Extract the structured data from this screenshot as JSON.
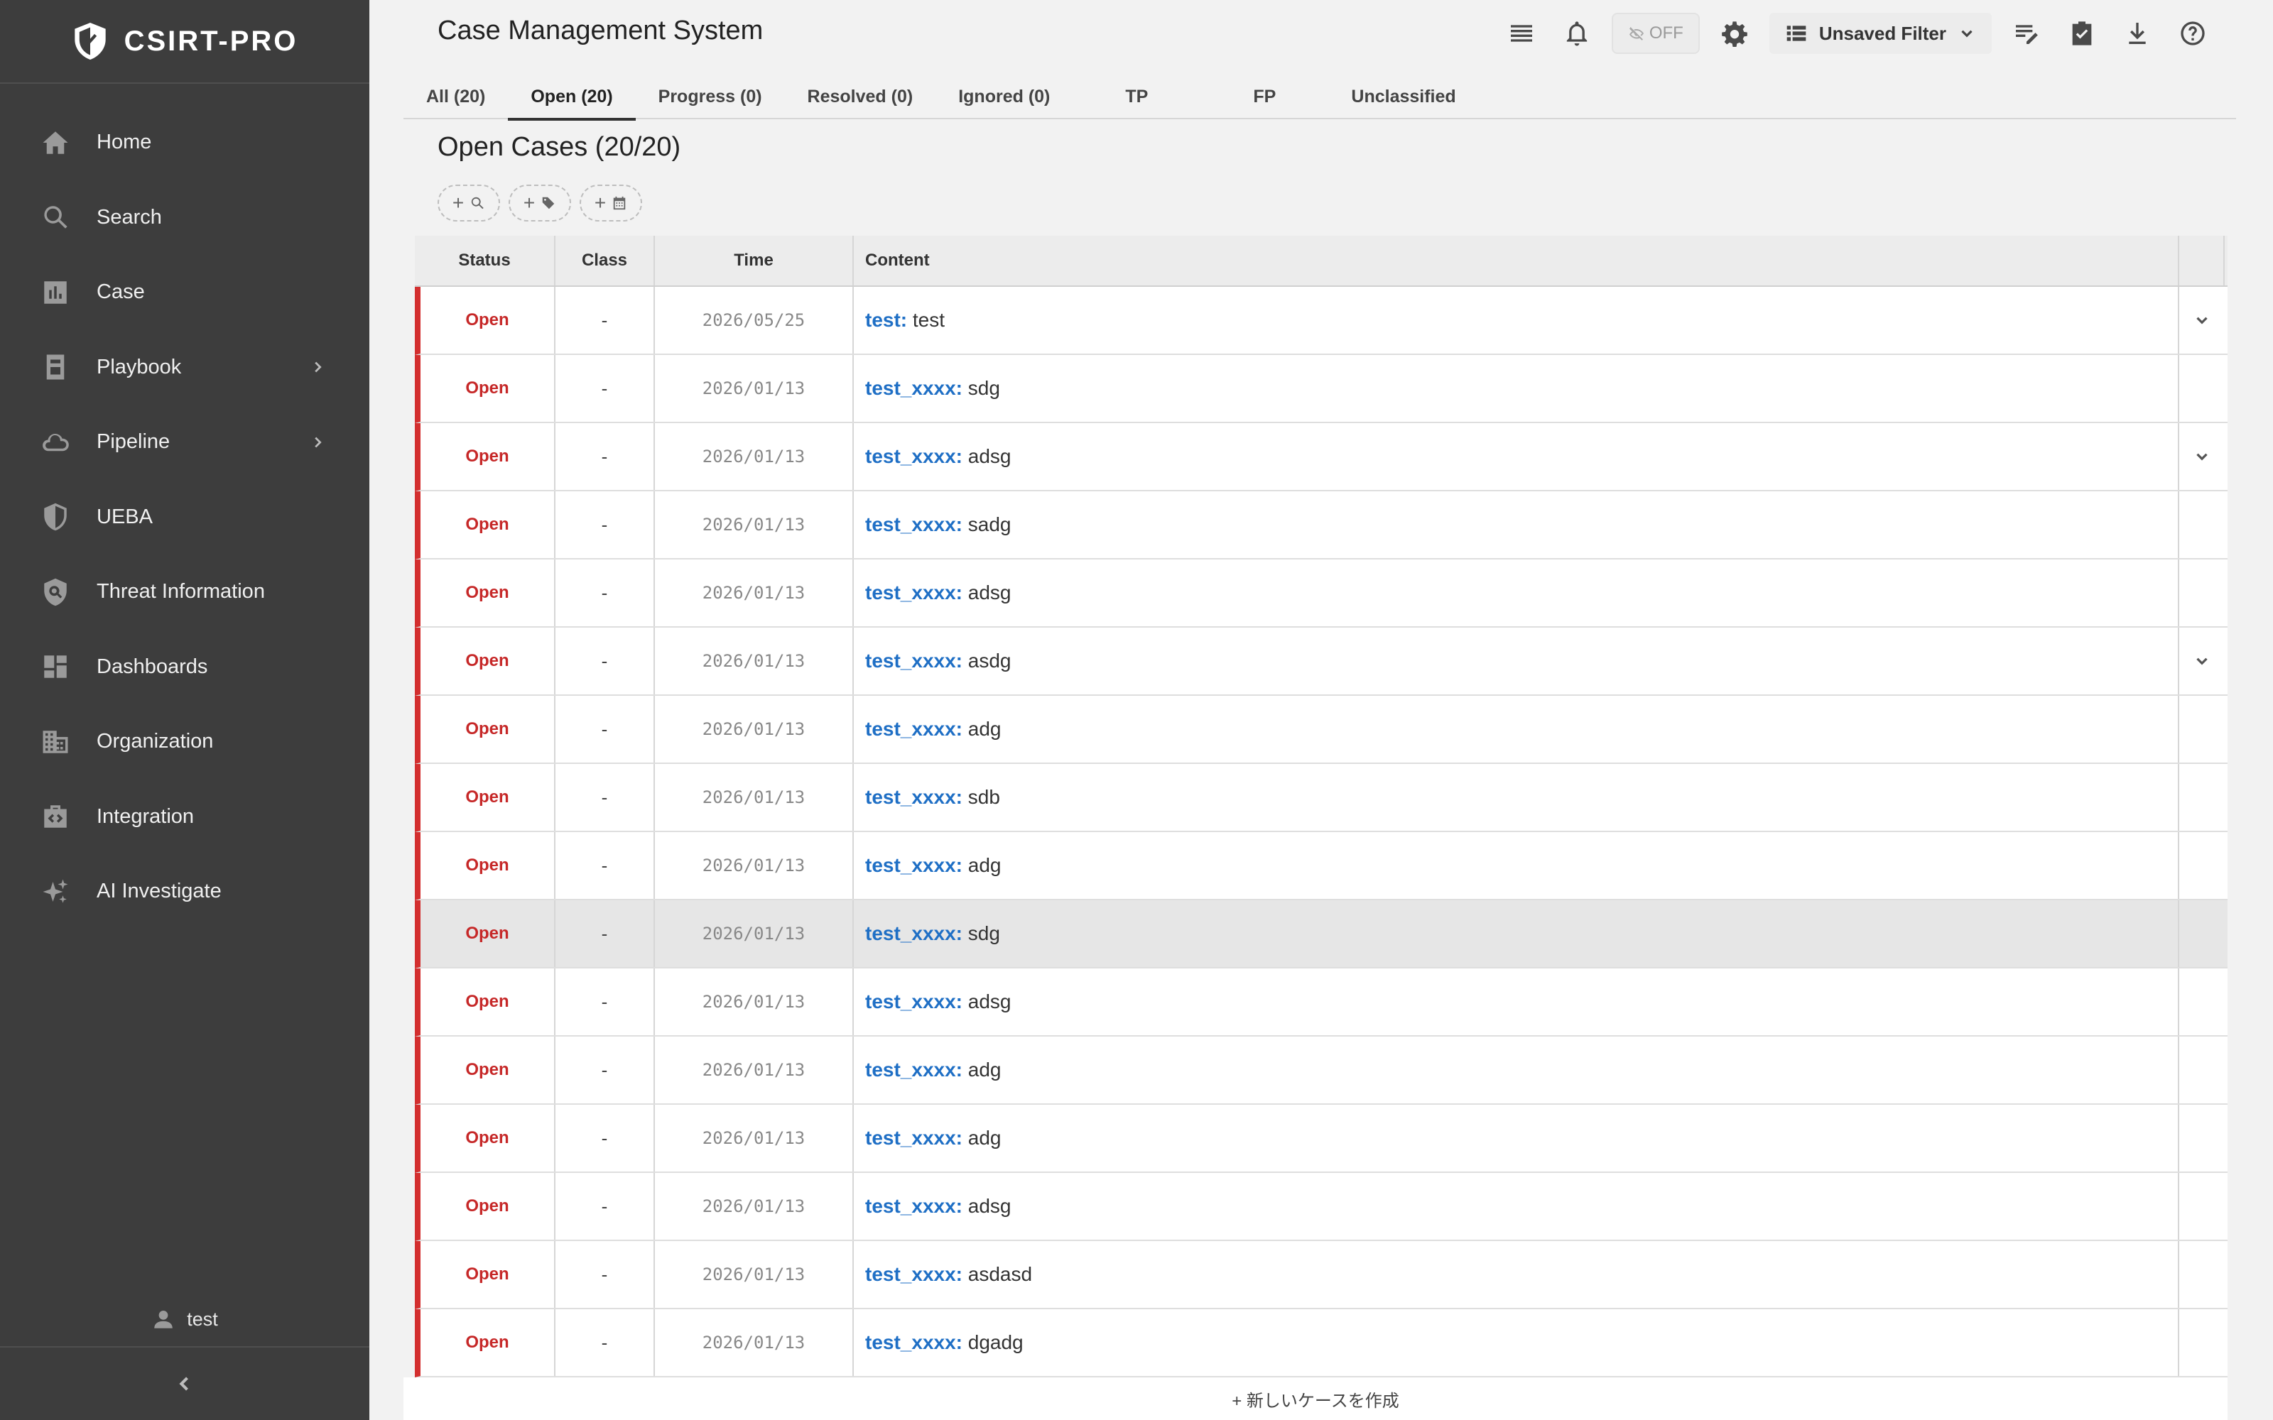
{
  "brand": {
    "name": "CSIRT-PRO",
    "icon": "shield-icon"
  },
  "sidebar": {
    "items": [
      {
        "label": "Home",
        "icon": "home-icon"
      },
      {
        "label": "Search",
        "icon": "search-icon"
      },
      {
        "label": "Case",
        "icon": "chart-icon"
      },
      {
        "label": "Playbook",
        "icon": "book-icon",
        "has_children": true
      },
      {
        "label": "Pipeline",
        "icon": "cloud-icon",
        "has_children": true
      },
      {
        "label": "UEBA",
        "icon": "shield-half-icon"
      },
      {
        "label": "Threat Information",
        "icon": "threat-shield-icon"
      },
      {
        "label": "Dashboards",
        "icon": "dashboard-icon"
      },
      {
        "label": "Organization",
        "icon": "building-icon"
      },
      {
        "label": "Integration",
        "icon": "integration-icon"
      },
      {
        "label": "AI Investigate",
        "icon": "sparkle-icon"
      }
    ],
    "user": "test"
  },
  "header": {
    "title": "Case Management System",
    "toggle_label": "OFF",
    "filter_label": "Unsaved Filter"
  },
  "tabs": [
    {
      "label": "All (20)"
    },
    {
      "label": "Open (20)",
      "active": true
    },
    {
      "label": "Progress (0)"
    },
    {
      "label": "Resolved (0)"
    },
    {
      "label": "Ignored (0)"
    },
    {
      "label": "TP"
    },
    {
      "label": "FP"
    },
    {
      "label": "Unclassified"
    }
  ],
  "section_title": "Open Cases (20/20)",
  "table": {
    "headers": {
      "status": "Status",
      "class": "Class",
      "time": "Time",
      "content": "Content"
    },
    "rows": [
      {
        "status": "Open",
        "class": "-",
        "time": "2026/05/25",
        "name": "test:",
        "desc": "test",
        "expand": true
      },
      {
        "status": "Open",
        "class": "-",
        "time": "2026/01/13",
        "name": "test_xxxx:",
        "desc": "sdg",
        "expand": false
      },
      {
        "status": "Open",
        "class": "-",
        "time": "2026/01/13",
        "name": "test_xxxx:",
        "desc": "adsg",
        "expand": true
      },
      {
        "status": "Open",
        "class": "-",
        "time": "2026/01/13",
        "name": "test_xxxx:",
        "desc": "sadg",
        "expand": false
      },
      {
        "status": "Open",
        "class": "-",
        "time": "2026/01/13",
        "name": "test_xxxx:",
        "desc": "adsg",
        "expand": false
      },
      {
        "status": "Open",
        "class": "-",
        "time": "2026/01/13",
        "name": "test_xxxx:",
        "desc": "asdg",
        "expand": true
      },
      {
        "status": "Open",
        "class": "-",
        "time": "2026/01/13",
        "name": "test_xxxx:",
        "desc": "adg",
        "expand": false
      },
      {
        "status": "Open",
        "class": "-",
        "time": "2026/01/13",
        "name": "test_xxxx:",
        "desc": "sdb",
        "expand": false
      },
      {
        "status": "Open",
        "class": "-",
        "time": "2026/01/13",
        "name": "test_xxxx:",
        "desc": "adg",
        "expand": false
      },
      {
        "status": "Open",
        "class": "-",
        "time": "2026/01/13",
        "name": "test_xxxx:",
        "desc": "sdg",
        "expand": false,
        "highlight": true
      },
      {
        "status": "Open",
        "class": "-",
        "time": "2026/01/13",
        "name": "test_xxxx:",
        "desc": "adsg",
        "expand": false
      },
      {
        "status": "Open",
        "class": "-",
        "time": "2026/01/13",
        "name": "test_xxxx:",
        "desc": "adg",
        "expand": false
      },
      {
        "status": "Open",
        "class": "-",
        "time": "2026/01/13",
        "name": "test_xxxx:",
        "desc": "adg",
        "expand": false
      },
      {
        "status": "Open",
        "class": "-",
        "time": "2026/01/13",
        "name": "test_xxxx:",
        "desc": "adsg",
        "expand": false
      },
      {
        "status": "Open",
        "class": "-",
        "time": "2026/01/13",
        "name": "test_xxxx:",
        "desc": "asdasd",
        "expand": false
      },
      {
        "status": "Open",
        "class": "-",
        "time": "2026/01/13",
        "name": "test_xxxx:",
        "desc": "dgadg",
        "expand": false
      }
    ]
  },
  "footer": {
    "create_label": "+ 新しいケースを作成"
  },
  "colors": {
    "sidebar_bg": "#3d3d3d",
    "status_open": "#c62828",
    "row_accent": "#d32f2f",
    "link": "#1f6fc5"
  }
}
